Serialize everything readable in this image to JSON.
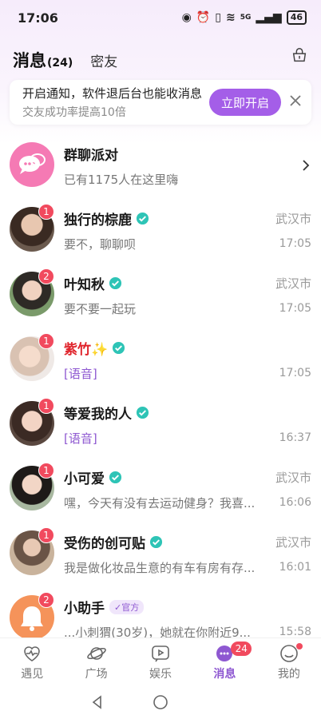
{
  "status": {
    "time": "17:06",
    "network": "5G",
    "battery": "46"
  },
  "header": {
    "title": "消息",
    "count": "(24)",
    "tab2": "密友"
  },
  "banner": {
    "title": "开启通知，软件退后台也能收消息",
    "subtitle": "交友成功率提高10倍",
    "button": "立即开启"
  },
  "colors": {
    "accent": "#a45ee8",
    "badge": "#f14a5e",
    "verified": "#2ec4b6"
  },
  "conversations": [
    {
      "name": "群聊派对",
      "message": "已有1175人在这里嗨"
    },
    {
      "name": "独行的棕鹿",
      "badge": "1",
      "city": "武汉市",
      "message": "要不，聊聊呗",
      "time": "17:05"
    },
    {
      "name": "叶知秋",
      "badge": "2",
      "city": "武汉市",
      "message": "要不要一起玩",
      "time": "17:05"
    },
    {
      "name": "紫竹✨",
      "badge": "1",
      "message": "[语音]",
      "time": "17:05"
    },
    {
      "name": "等爱我的人",
      "badge": "1",
      "message": "[语音]",
      "time": "16:37"
    },
    {
      "name": "小可爱",
      "badge": "1",
      "city": "武汉市",
      "message": "嘿，今天有没有去运动健身？我喜...",
      "time": "16:06"
    },
    {
      "name": "受伤的创可贴",
      "badge": "1",
      "city": "武汉市",
      "message": "我是做化妆品生意的有车有房有存...",
      "time": "16:01"
    },
    {
      "name": "小助手",
      "badge": "2",
      "tag": "官方",
      "message": "...小刺猬(30岁)，她就在你附近9...",
      "time": "15:58"
    }
  ],
  "tabbar": [
    {
      "label": "遇见",
      "icon": "heart-pulse-icon"
    },
    {
      "label": "广场",
      "icon": "planet-icon"
    },
    {
      "label": "娱乐",
      "icon": "play-chat-icon"
    },
    {
      "label": "消息",
      "icon": "message-icon",
      "badge": "24"
    },
    {
      "label": "我的",
      "icon": "smile-icon"
    }
  ]
}
